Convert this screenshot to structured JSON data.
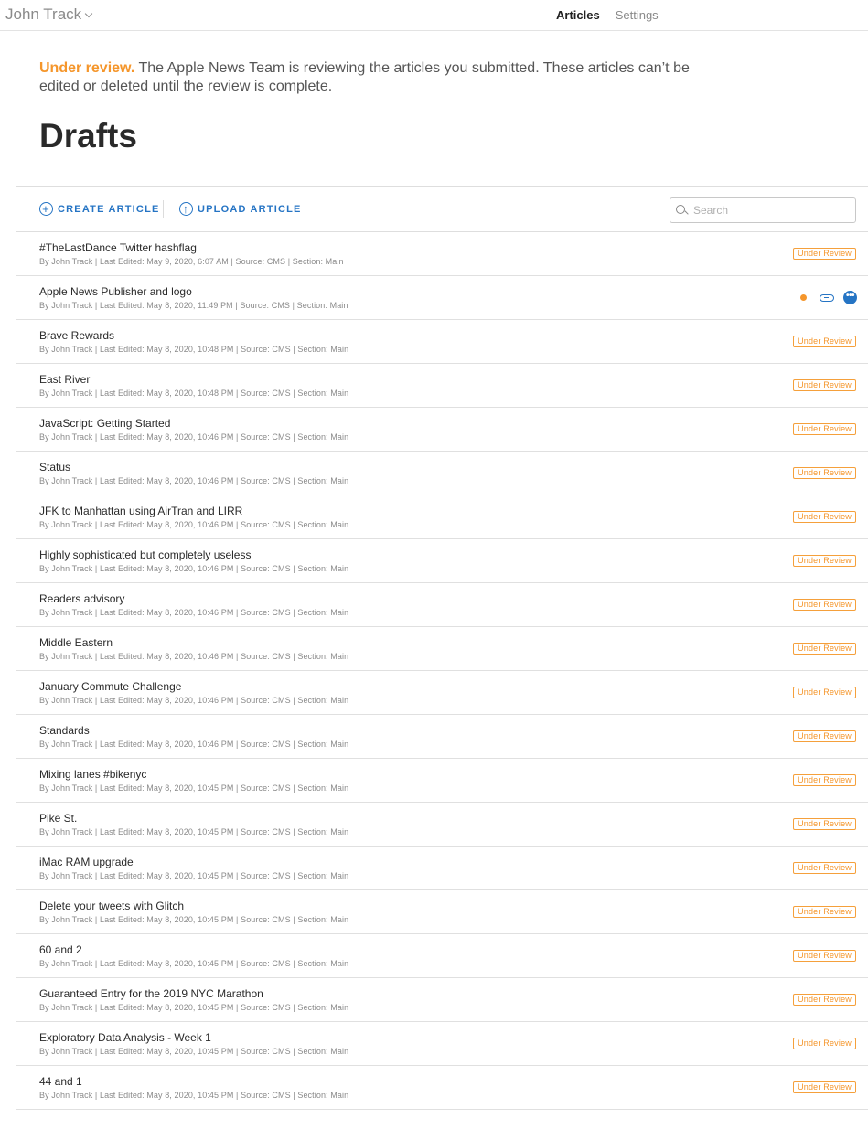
{
  "header": {
    "account_name": "John Track",
    "tabs": [
      {
        "label": "Articles",
        "active": true
      },
      {
        "label": "Settings",
        "active": false
      }
    ]
  },
  "notice": {
    "lead": "Under review.",
    "text": " The Apple News Team is reviewing the articles you submitted. These articles can’t be edited or deleted until the review is complete."
  },
  "page_title": "Drafts",
  "toolbar": {
    "create_label": "CREATE ARTICLE",
    "upload_label": "UPLOAD ARTICLE",
    "search_placeholder": "Search"
  },
  "colors": {
    "accent": "#2574c4",
    "review": "#f5962b"
  },
  "badge_label": "Under Review",
  "articles": [
    {
      "title": "#TheLastDance Twitter hashflag",
      "meta": "By John Track | Last Edited: May 9, 2020, 6:07 AM | Source: CMS | Section: Main",
      "status": "review"
    },
    {
      "title": "Apple News Publisher and logo",
      "meta": "By John Track | Last Edited: May 8, 2020, 11:49 PM | Source: CMS | Section: Main",
      "status": "actions"
    },
    {
      "title": "Brave Rewards",
      "meta": "By John Track | Last Edited: May 8, 2020, 10:48 PM | Source: CMS | Section: Main",
      "status": "review"
    },
    {
      "title": "East River",
      "meta": "By John Track | Last Edited: May 8, 2020, 10:48 PM | Source: CMS | Section: Main",
      "status": "review"
    },
    {
      "title": "JavaScript: Getting Started",
      "meta": "By John Track | Last Edited: May 8, 2020, 10:46 PM | Source: CMS | Section: Main",
      "status": "review"
    },
    {
      "title": "Status",
      "meta": "By John Track | Last Edited: May 8, 2020, 10:46 PM | Source: CMS | Section: Main",
      "status": "review"
    },
    {
      "title": "JFK to Manhattan using AirTran and LIRR",
      "meta": "By John Track | Last Edited: May 8, 2020, 10:46 PM | Source: CMS | Section: Main",
      "status": "review"
    },
    {
      "title": "Highly sophisticated but completely useless",
      "meta": "By John Track | Last Edited: May 8, 2020, 10:46 PM | Source: CMS | Section: Main",
      "status": "review"
    },
    {
      "title": "Readers advisory",
      "meta": "By John Track | Last Edited: May 8, 2020, 10:46 PM | Source: CMS | Section: Main",
      "status": "review"
    },
    {
      "title": "Middle Eastern",
      "meta": "By John Track | Last Edited: May 8, 2020, 10:46 PM | Source: CMS | Section: Main",
      "status": "review"
    },
    {
      "title": "January Commute Challenge",
      "meta": "By John Track | Last Edited: May 8, 2020, 10:46 PM | Source: CMS | Section: Main",
      "status": "review"
    },
    {
      "title": "Standards",
      "meta": "By John Track | Last Edited: May 8, 2020, 10:46 PM | Source: CMS | Section: Main",
      "status": "review"
    },
    {
      "title": "Mixing lanes #bikenyc",
      "meta": "By John Track | Last Edited: May 8, 2020, 10:45 PM | Source: CMS | Section: Main",
      "status": "review"
    },
    {
      "title": "Pike St.",
      "meta": "By John Track | Last Edited: May 8, 2020, 10:45 PM | Source: CMS | Section: Main",
      "status": "review"
    },
    {
      "title": "iMac RAM upgrade",
      "meta": "By John Track | Last Edited: May 8, 2020, 10:45 PM | Source: CMS | Section: Main",
      "status": "review"
    },
    {
      "title": "Delete your tweets with Glitch",
      "meta": "By John Track | Last Edited: May 8, 2020, 10:45 PM | Source: CMS | Section: Main",
      "status": "review"
    },
    {
      "title": "60 and 2",
      "meta": "By John Track | Last Edited: May 8, 2020, 10:45 PM | Source: CMS | Section: Main",
      "status": "review"
    },
    {
      "title": "Guaranteed Entry for the 2019 NYC Marathon",
      "meta": "By John Track | Last Edited: May 8, 2020, 10:45 PM | Source: CMS | Section: Main",
      "status": "review"
    },
    {
      "title": "Exploratory Data Analysis - Week 1",
      "meta": "By John Track | Last Edited: May 8, 2020, 10:45 PM | Source: CMS | Section: Main",
      "status": "review"
    },
    {
      "title": "44 and 1",
      "meta": "By John Track | Last Edited: May 8, 2020, 10:45 PM | Source: CMS | Section: Main",
      "status": "review"
    }
  ]
}
